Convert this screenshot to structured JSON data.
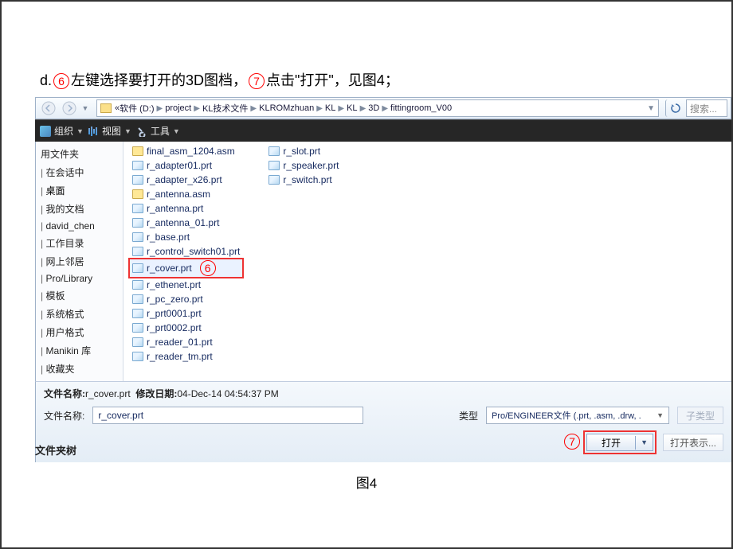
{
  "instruction": {
    "prefix": "d.",
    "circle6": "6",
    "part1": "左键选择要打开的3D图档，",
    "circle7": "7",
    "part2": "点击\"打开\"，见图4；"
  },
  "breadcrumb": {
    "lead": "«",
    "items": [
      "软件 (D:)",
      "project",
      "KL技术文件",
      "KLROMzhuan",
      "KL",
      "KL",
      "3D",
      "fittingroom_V00"
    ]
  },
  "search_placeholder": "搜索...",
  "toolbar": {
    "organize": "组织",
    "view": "视图",
    "tools": "工具"
  },
  "sidebar": [
    {
      "prefix": "",
      "label": "用文件夹"
    },
    {
      "prefix": "|",
      "label": " 在会话中"
    },
    {
      "prefix": "|",
      "label": " 桌面"
    },
    {
      "prefix": "|",
      "label": " 我的文档"
    },
    {
      "prefix": "|",
      "label": " david_chen"
    },
    {
      "prefix": "|",
      "label": " 工作目录"
    },
    {
      "prefix": "|",
      "label": " 网上邻居"
    },
    {
      "prefix": "|",
      "label": " Pro/Library"
    },
    {
      "prefix": "|",
      "label": " 模板"
    },
    {
      "prefix": "|",
      "label": " 系统格式"
    },
    {
      "prefix": "|",
      "label": " 用户格式"
    },
    {
      "prefix": "|",
      "label": " Manikin 库"
    },
    {
      "prefix": "|",
      "label": " 收藏夹"
    }
  ],
  "files_col1": [
    {
      "name": "final_asm_1204.asm",
      "type": "asm"
    },
    {
      "name": "r_adapter01.prt",
      "type": "prt"
    },
    {
      "name": "r_adapter_x26.prt",
      "type": "prt"
    },
    {
      "name": "r_antenna.asm",
      "type": "asm"
    },
    {
      "name": "r_antenna.prt",
      "type": "prt"
    },
    {
      "name": "r_antenna_01.prt",
      "type": "prt"
    },
    {
      "name": "r_base.prt",
      "type": "prt"
    },
    {
      "name": "r_control_switch01.prt",
      "type": "prt"
    },
    {
      "name": "r_cover.prt",
      "type": "prt",
      "selected": true
    },
    {
      "name": "r_ethenet.prt",
      "type": "prt"
    },
    {
      "name": "r_pc_zero.prt",
      "type": "prt"
    },
    {
      "name": "r_prt0001.prt",
      "type": "prt"
    },
    {
      "name": "r_prt0002.prt",
      "type": "prt"
    },
    {
      "name": "r_reader_01.prt",
      "type": "prt"
    },
    {
      "name": "r_reader_tm.prt",
      "type": "prt"
    }
  ],
  "files_col2": [
    {
      "name": "r_slot.prt",
      "type": "prt"
    },
    {
      "name": "r_speaker.prt",
      "type": "prt"
    },
    {
      "name": "r_switch.prt",
      "type": "prt"
    }
  ],
  "annot_circle6": "6",
  "footer": {
    "info_label": "文件名称:",
    "info_filename": "r_cover.prt",
    "info_mod_label": "修改日期:",
    "info_mod_date": "04-Dec-14 04:54:37 PM",
    "filename_label": "文件名称:",
    "filename_value": "r_cover.prt",
    "type_label": "类型",
    "type_value": "Pro/ENGINEER文件 (.prt, .asm, .drw, .",
    "subtype_label": "子类型",
    "open_btn": "打开",
    "open_rep": "打开表示...",
    "annot7": "7"
  },
  "leftcol_label": "文件夹树",
  "figure_label": "图4"
}
